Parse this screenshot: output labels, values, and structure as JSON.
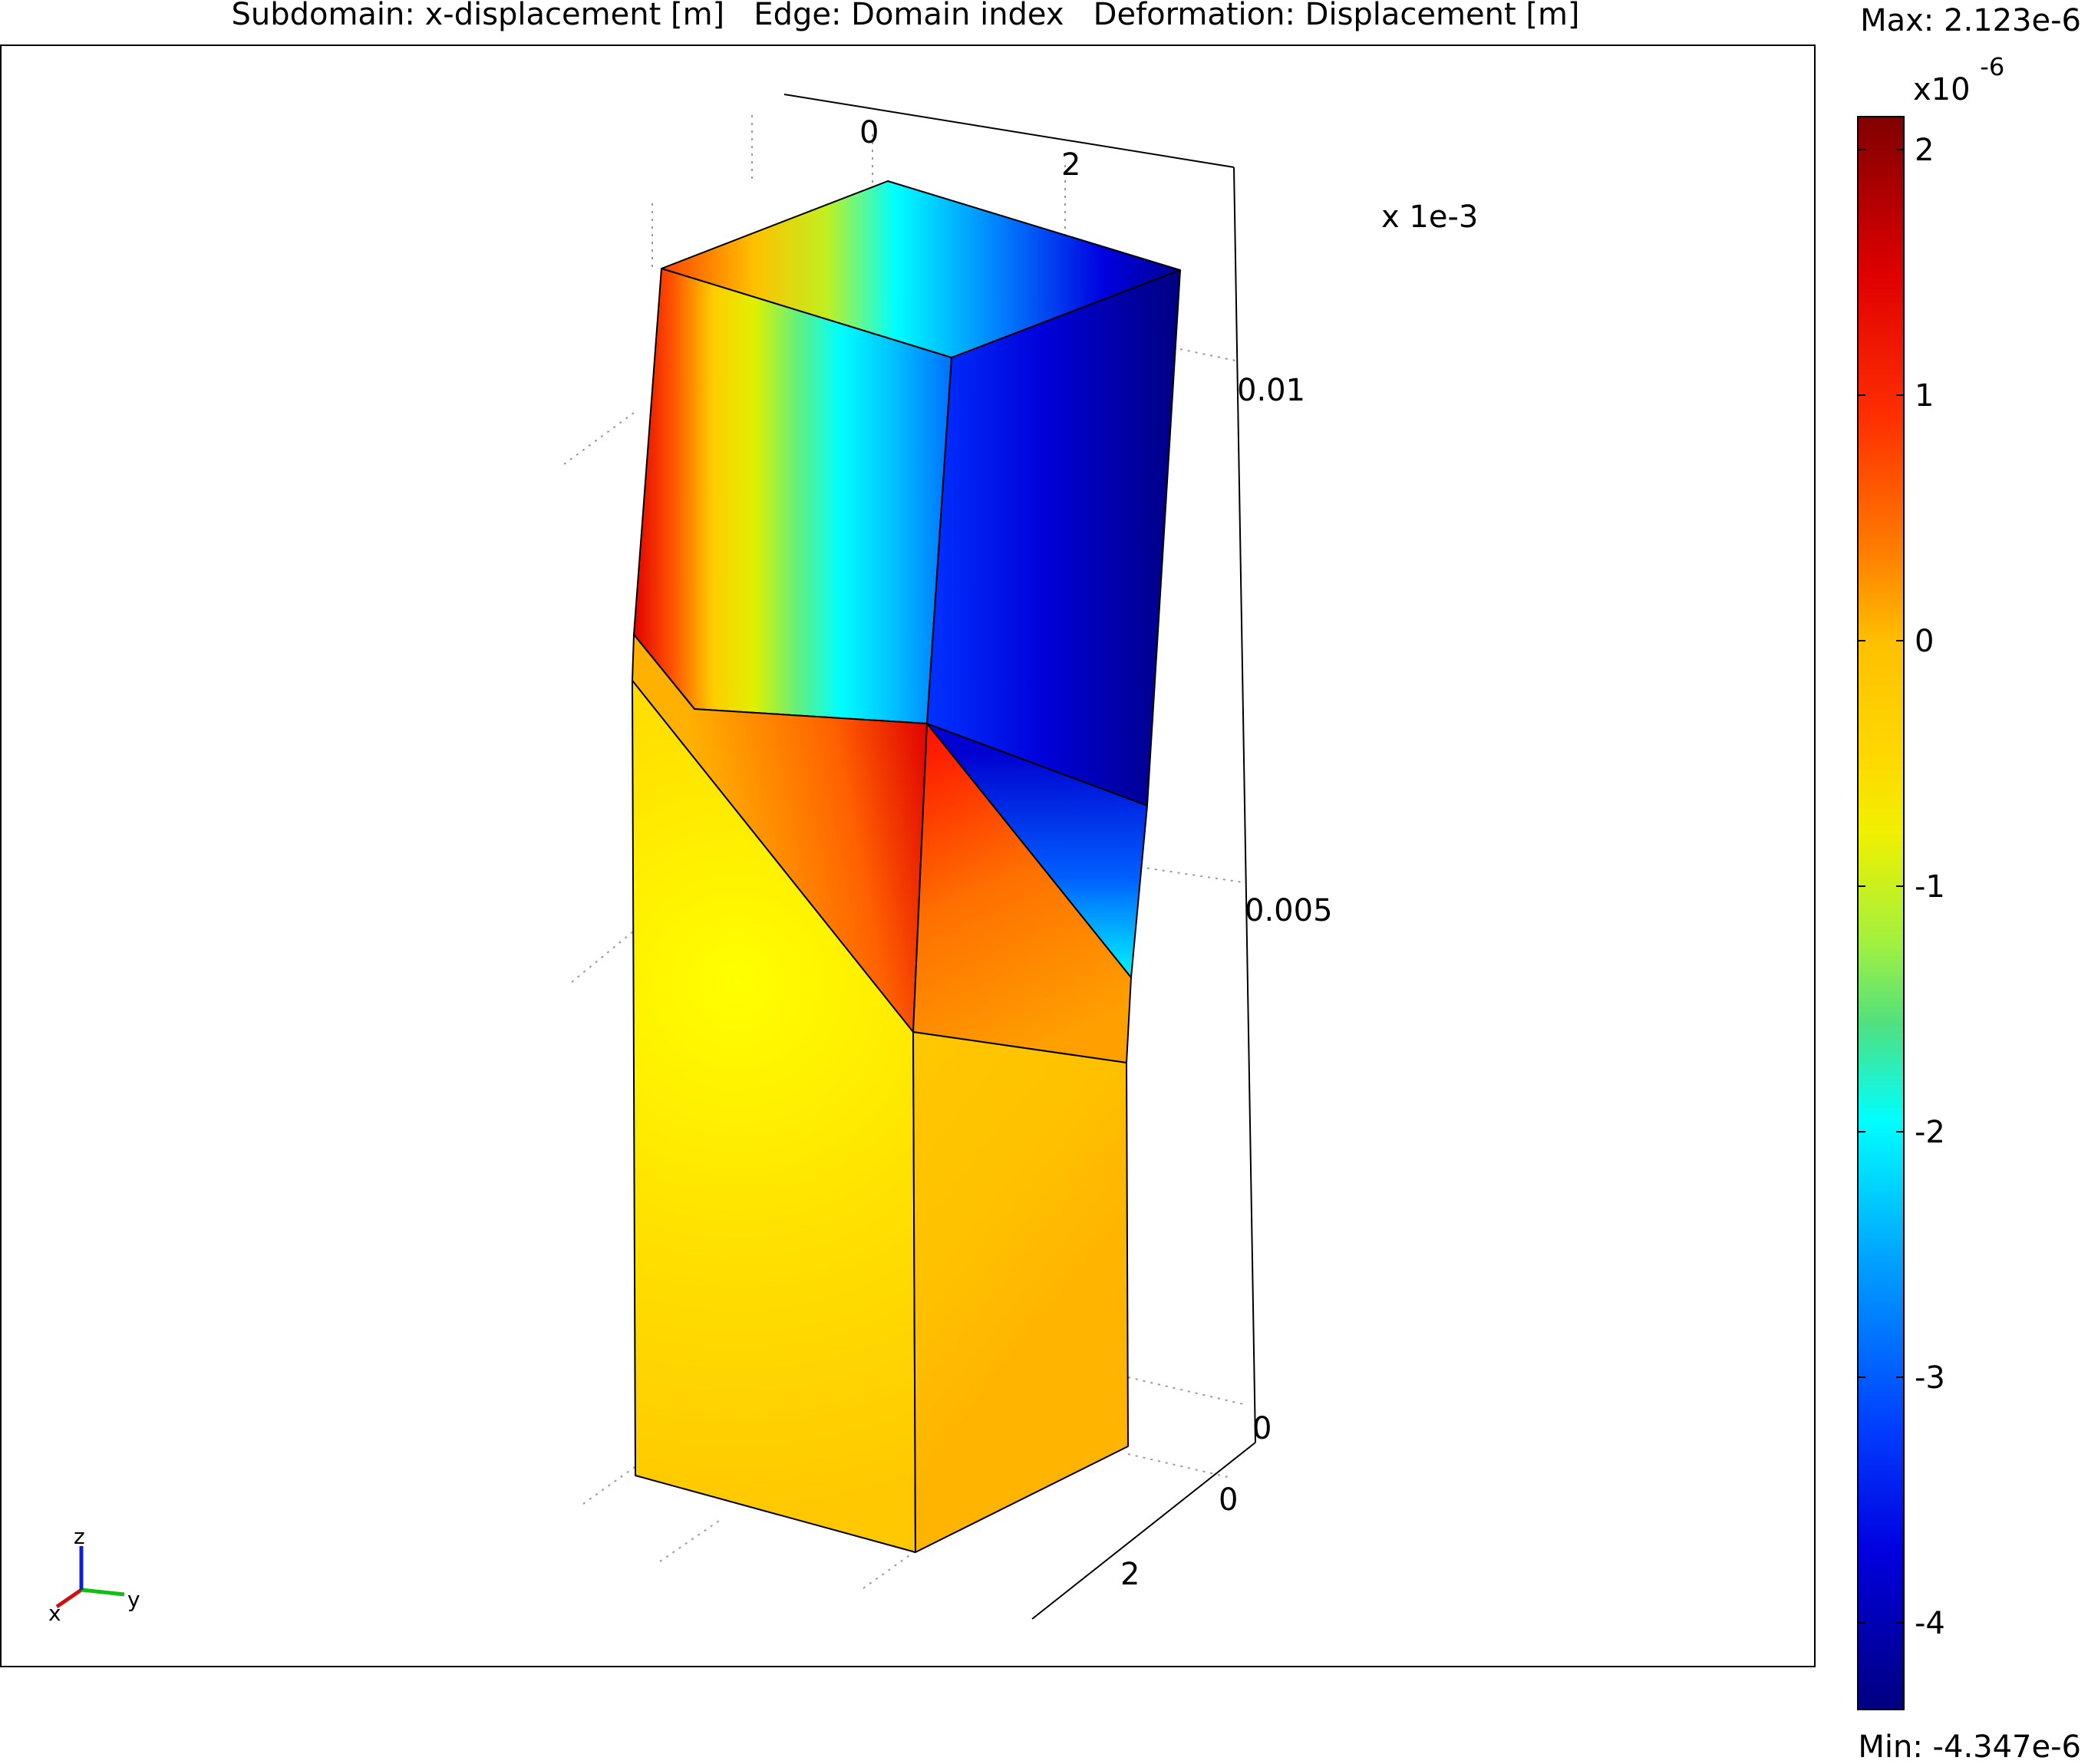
{
  "plot": {
    "title": "Subdomain: x-displacement [m]   Edge: Domain index   Deformation: Displacement [m]",
    "scale_factor": "x 1e-3",
    "x_ticks": [
      "0",
      "2"
    ],
    "y_ticks": [
      "0",
      "2"
    ],
    "z_ticks": [
      "0.01",
      "0.005",
      "0"
    ]
  },
  "axes_triad": {
    "x_label": "x",
    "y_label": "y",
    "z_label": "z",
    "x_color": "#d01010",
    "y_color": "#10c010",
    "z_color": "#1020d0"
  },
  "colorbar": {
    "max_label": "Max: 2.123e-6",
    "min_label": "Min: -4.347e-6",
    "multiplier_base": "x10",
    "multiplier_exp": "-6",
    "ticks": [
      "2",
      "1",
      "0",
      "-1",
      "-2",
      "-3",
      "-4"
    ],
    "colormap": "jet",
    "value_max": 2.123,
    "value_min": -4.347
  }
}
